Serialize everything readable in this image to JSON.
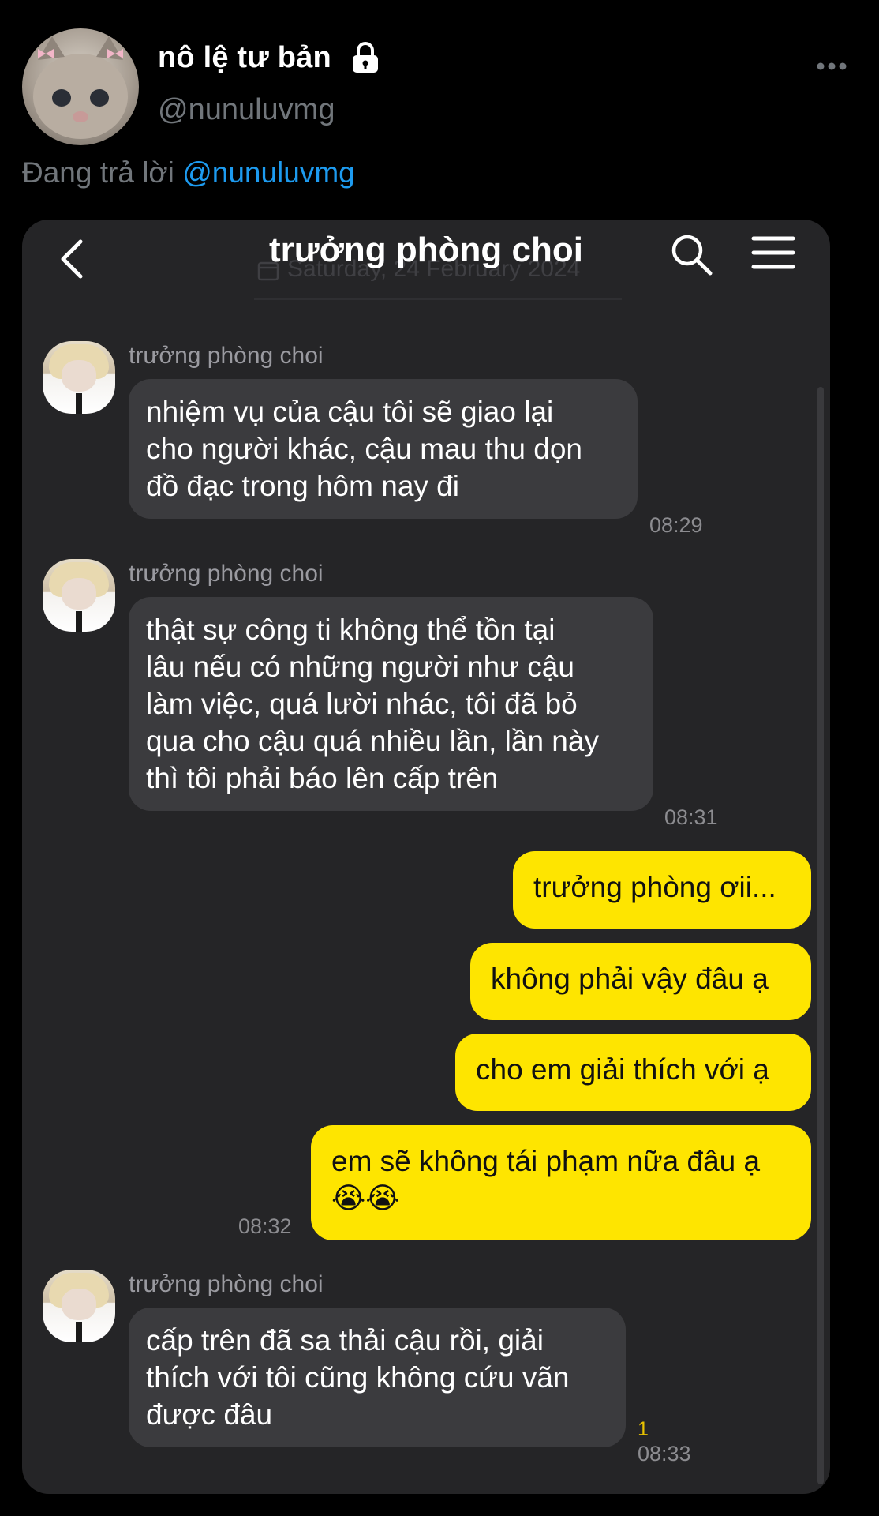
{
  "tweet": {
    "display_name": "nô lệ tư bản",
    "handle": "@nunuluvmg",
    "reply_prefix": "Đang trả lời",
    "reply_to": "@nunuluvmg"
  },
  "chat": {
    "title": "trưởng phòng choi",
    "date_separator": "Saturday, 24 February 2024",
    "messages": [
      {
        "sender": "trưởng phòng choi",
        "lines": [
          "nhiệm vụ của cậu tôi sẽ giao lại",
          "cho người khác, cậu mau thu dọn",
          "đồ đạc trong hôm nay đi"
        ],
        "time": "08:29"
      },
      {
        "sender": "trưởng phòng choi",
        "lines": [
          "thật sự công ti không thể tồn tại",
          "lâu nếu có những người như cậu",
          "làm việc, quá lười nhác, tôi đã bỏ",
          "qua cho cậu quá nhiều lần, lần này",
          "thì tôi phải báo lên cấp trên"
        ],
        "time": "08:31"
      },
      {
        "lines": [
          "trưởng phòng ơii..."
        ]
      },
      {
        "lines": [
          "không phải vậy đâu ạ"
        ]
      },
      {
        "lines": [
          "cho em giải thích với ạ"
        ]
      },
      {
        "lines": [
          "em sẽ không tái phạm nữa đâu ạ",
          "😭😭"
        ],
        "time": "08:32"
      },
      {
        "sender": "trưởng phòng choi",
        "lines": [
          "cấp trên đã sa thải cậu rồi, giải",
          "thích với tôi cũng không cứu vãn",
          "được đâu"
        ],
        "time": "08:33",
        "unread": "1"
      }
    ]
  },
  "colors": {
    "outgoing_bubble": "#fee500",
    "incoming_bubble": "#3b3b3e",
    "card_bg": "#252527",
    "mention": "#1d9bf0"
  },
  "icons": [
    "lock-icon",
    "more-icon",
    "back-icon",
    "search-icon",
    "menu-icon"
  ]
}
